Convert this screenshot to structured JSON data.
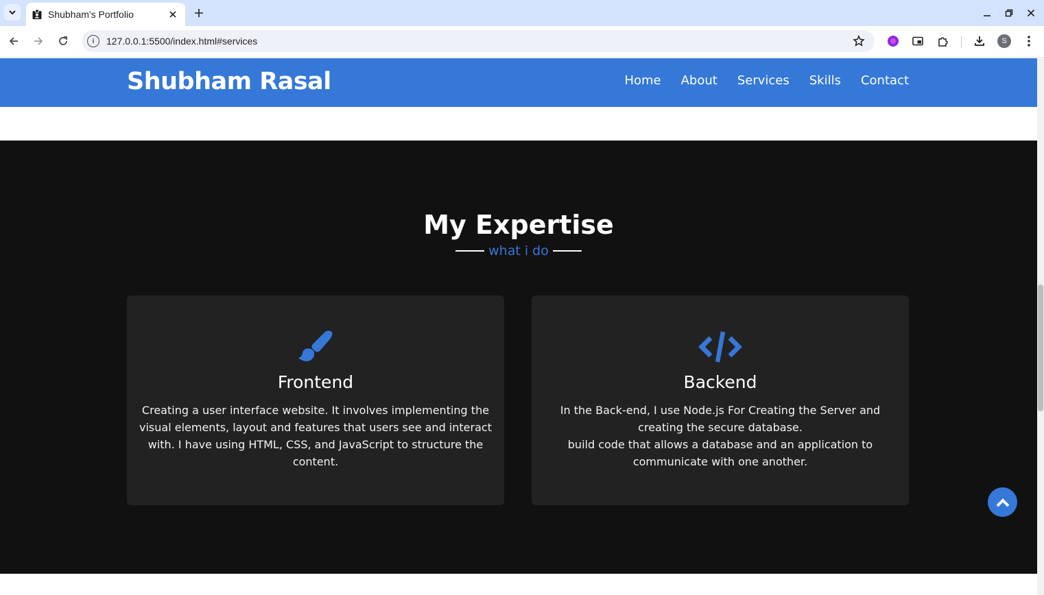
{
  "browser": {
    "tab_title": "Shubham's Portfolio",
    "url": "127.0.0.1:5500/index.html#services",
    "profile_initial": "S"
  },
  "page": {
    "brand": "Shubham Rasal",
    "nav": [
      "Home",
      "About",
      "Services",
      "Skills",
      "Contact"
    ],
    "services": {
      "title": "My Expertise",
      "subtitle": "what i do",
      "cards": [
        {
          "icon": "paintbrush-icon",
          "title": "Frontend",
          "text": "Creating a user interface website. It involves implementing the visual elements, layout and features that users see and interact with. I have using HTML, CSS, and JavaScript to structure the content."
        },
        {
          "icon": "code-icon",
          "title": "Backend",
          "text": "In the Back-end, I use Node.js For Creating the Server and creating the secure database.\nbuild code that allows a database and an application to communicate with one another."
        }
      ]
    }
  },
  "colors": {
    "accent": "#3578d8",
    "section_bg": "#111111",
    "card_bg": "#222222"
  }
}
